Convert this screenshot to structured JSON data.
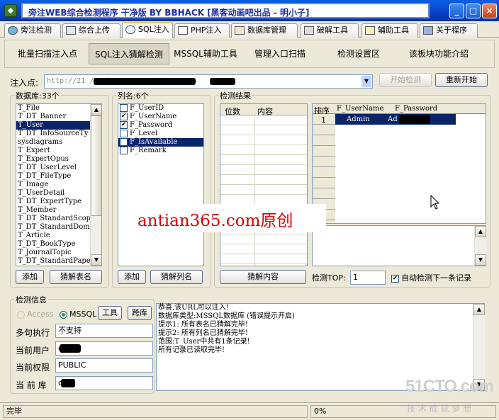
{
  "window": {
    "title": "旁注WEB综合检测程序 干净版 BY BBHACK      [黑客动画吧出品 - 明小子]",
    "app_icon": "app-icon",
    "controls": [
      "_",
      "□",
      "×"
    ]
  },
  "tabs": [
    {
      "label": "旁注检测",
      "icon": "globe-icon"
    },
    {
      "label": "综合上传",
      "icon": "chart-icon"
    },
    {
      "label": "SQL注入",
      "icon": "magnifier-icon"
    },
    {
      "label": "PHP注入",
      "icon": "page-icon"
    },
    {
      "label": "数据库管理",
      "icon": "database-icon"
    },
    {
      "label": "破解工具",
      "icon": "keyboard-icon"
    },
    {
      "label": "辅助工具",
      "icon": "clipboard-icon"
    },
    {
      "label": "关于程序",
      "icon": "book-icon"
    }
  ],
  "subnav": [
    "批量扫描注入点",
    "SQL注入猜解检测",
    "MSSQL辅助工具",
    "管理入口扫描",
    "检测设置区",
    "该板块功能介绍"
  ],
  "url_bar": {
    "label": "注入点:",
    "value": "http://21                              /Book         .aspx?typeid=1",
    "start_button": "开始检测",
    "restart_button": "重新开始"
  },
  "db_panel": {
    "label": "数据库:33个",
    "items": [
      "T_File",
      "T_DT_Banner",
      "T_User",
      "T_DT_InfoSourceTy",
      "sysdiagrams",
      "T_Expert",
      "T_ExpertOpus",
      "T_DT_UserLevel",
      "T_DT_FileType",
      "T_Image",
      "T_UserDetail",
      "T_DT_ExpertType",
      "T_Member",
      "T_DT_StandardScop",
      "T_DT_StandardDoms",
      "T_Article",
      "T_DT_BookType",
      "T_JournalTopic",
      "T_DT_StandardPape"
    ],
    "selected_index": 2,
    "add_button": "添加",
    "guess_button": "猜解表名"
  },
  "col_panel": {
    "label": "列名:6个",
    "items": [
      {
        "name": "F_UserID",
        "checked": false
      },
      {
        "name": "F_UserName",
        "checked": true
      },
      {
        "name": "F_Password",
        "checked": true
      },
      {
        "name": "F_Level",
        "checked": false
      },
      {
        "name": "F_IsAvailable",
        "checked": false
      },
      {
        "name": "F_Remark",
        "checked": false
      }
    ],
    "selected_index": 4,
    "add_button": "添加",
    "guess_button": "猜解列名"
  },
  "result_panel": {
    "label": "检测结果",
    "left_headers": [
      "位数",
      "内容"
    ],
    "grid_headers": [
      "排序",
      "F_UserName",
      "F_Password"
    ],
    "rows": [
      {
        "index": "1",
        "username": "Admin",
        "password": "Ad        OP"
      }
    ],
    "guess_content_button": "猜解内容",
    "top_label": "检测TOP:",
    "top_value": "1",
    "auto_next_label": "自动检测下一条记录",
    "auto_next_checked": true
  },
  "info_panel": {
    "label": "检测信息",
    "radio_access": "Access",
    "radio_mssql": "MSSQL",
    "radio_selected": "MSSQL",
    "tools_button": "工具",
    "cross_db_button": "跨库",
    "fields": [
      {
        "label": "多句执行",
        "value": "不支持"
      },
      {
        "label": "当前用户",
        "value": "d"
      },
      {
        "label": "当前权限",
        "value": "PUBLIC"
      },
      {
        "label": "当 前 库",
        "value": "c"
      }
    ],
    "log": [
      "恭喜,该URL可以注入!",
      "数据库类型:MSSQL数据库 (错误提示开启)",
      "提示1: 所有表名已猜解完毕!",
      "提示2: 所有列名已猜解完毕!",
      "范围:T_User中共有1条记录!",
      "所有记录已读取完毕!"
    ]
  },
  "overlay_text": "antian365.com原创",
  "watermark": {
    "brand": "51CTO.com",
    "slogan": "技 术 成 就 梦 想"
  },
  "status": {
    "left": "完毕",
    "progress": "0%"
  },
  "colors": {
    "title_bar": "#0842c6",
    "selection": "#0a246a",
    "overlay_text": "#d40000",
    "watermark": "#c8c8c8"
  }
}
